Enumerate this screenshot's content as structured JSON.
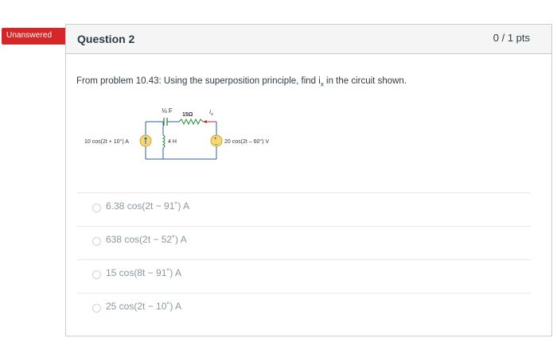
{
  "status_flag": {
    "label": "Unanswered",
    "color": "#d62728"
  },
  "question": {
    "title": "Question 2",
    "points": "0 / 1 pts",
    "text_main": "From problem 10.43: Using the superposition principle, find i",
    "text_sub": "x",
    "text_end": " in the circuit shown."
  },
  "circuit": {
    "current_source_label": "10 cos(2t + 10°) A",
    "capacitor_label": "1/8 F",
    "resistor_label": "15Ω",
    "inductor_label": "4 H",
    "current_label": "i",
    "current_label_sub": "x",
    "voltage_source_label": "20 cos(2t – 60°) V"
  },
  "answers": [
    {
      "text": "6.38 cos(2t − 91˚) A"
    },
    {
      "text": "638 cos(2t − 52˚) A"
    },
    {
      "text": "15 cos(8t − 91˚) A"
    },
    {
      "text": "25 cos(2t − 10˚) A"
    }
  ]
}
